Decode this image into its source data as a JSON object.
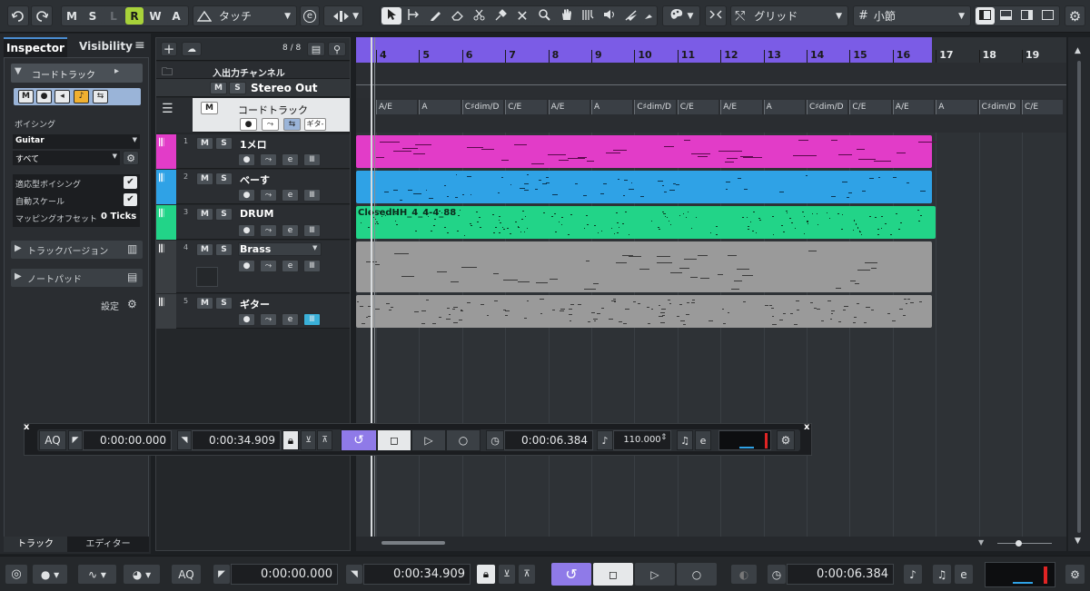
{
  "toolbar": {
    "mode_buttons": [
      "M",
      "S",
      "L",
      "R",
      "W",
      "A"
    ],
    "touch_mode": "タッチ",
    "snap_type": "グリッド",
    "grid_type": "小節",
    "e_label": "e"
  },
  "inspector": {
    "tabs": [
      "Inspector",
      "Visibility"
    ],
    "section_chord": "コードトラック",
    "voicing_label": "ボイシング",
    "voicing_value": "Guitar",
    "voicing_sub": "すべて",
    "adaptive_voicing": "適応型ボイシング",
    "auto_scale": "自動スケール",
    "mapping_offset_label": "マッピングオフセット",
    "mapping_offset_value": "0 Ticks",
    "track_versions": "トラックバージョン",
    "notepad": "ノートパッド",
    "settings": "設定",
    "bottom_tabs": [
      "トラック",
      "エディター"
    ]
  },
  "tracklist": {
    "count": "8 / 8",
    "io_channel": "入出力チャンネル",
    "stereo_out": "Stereo Out",
    "chord_track": "コードトラック",
    "guitar_btn": "ギタ-",
    "tracks": [
      {
        "num": "1",
        "name": "1メロ"
      },
      {
        "num": "2",
        "name": "べーす"
      },
      {
        "num": "3",
        "name": "DRUM"
      },
      {
        "num": "4",
        "name": "Brass"
      },
      {
        "num": "5",
        "name": "ギター"
      }
    ]
  },
  "ruler": {
    "bars": [
      "4",
      "5",
      "6",
      "7",
      "8",
      "9",
      "10",
      "11",
      "12",
      "13",
      "14",
      "15",
      "16",
      "17",
      "18",
      "19"
    ]
  },
  "chords": [
    "A/E",
    "A",
    "C♯dim/D",
    "C/E",
    "A/E",
    "A",
    "C♯dim/D",
    "C/E",
    "A/E",
    "A",
    "C♯dim/D",
    "C/E",
    "A/E",
    "A",
    "C♯dim/D",
    "C/E"
  ],
  "drum_part_name": "ClosedHH_4_4-4_88",
  "transport_float": {
    "aq": "AQ",
    "left_locator": "0:00:00.000",
    "right_locator": "0:00:34.909",
    "time": "0:00:06.384",
    "tempo": "110.000"
  },
  "transport_bottom": {
    "aq": "AQ",
    "left_locator": "0:00:00.000",
    "right_locator": "0:00:34.909",
    "time": "0:00:06.384"
  },
  "colors": {
    "ruler": "#7b5ce6",
    "melody": "#e23cc8",
    "bass": "#2fa2e6",
    "drum": "#22d488",
    "brass": "#9a9a9a",
    "guitar": "#9a9a9a",
    "record": "#a8d23a"
  }
}
